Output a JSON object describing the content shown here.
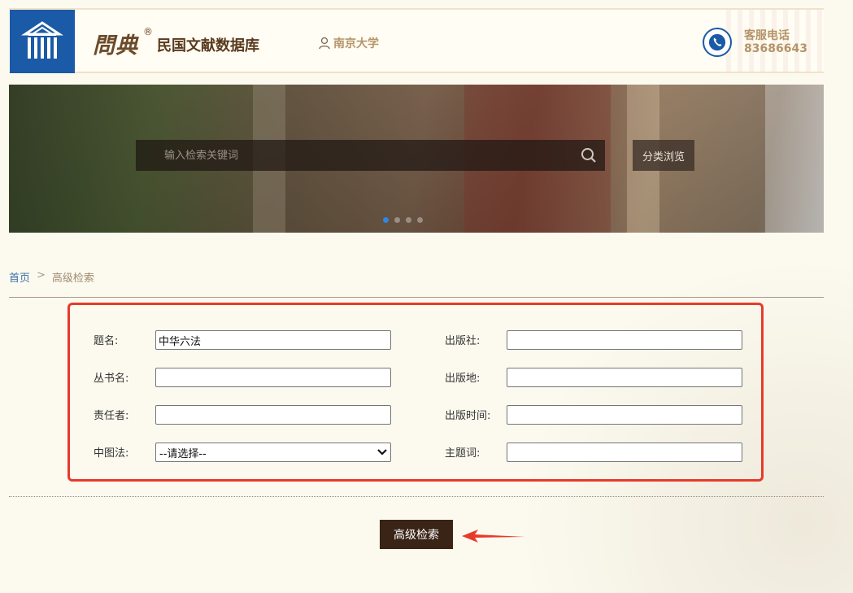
{
  "header": {
    "brand_calligraphy": "問典",
    "brand_registered": "®",
    "brand_name": "民国文献数据库",
    "user": "南京大学",
    "phone_label": "客服电话",
    "phone_number": "83686643"
  },
  "banner": {
    "search_placeholder": "输入检索关键词",
    "browse_label": "分类浏览",
    "active_slide": 1,
    "slide_count": 4
  },
  "breadcrumb": {
    "home": "首页",
    "separator": ">",
    "current": "高级检索"
  },
  "form": {
    "title_label": "题名:",
    "title_value": "中华六法",
    "series_label": "丛书名:",
    "series_value": "",
    "author_label": "责任者:",
    "author_value": "",
    "clc_label": "中图法:",
    "clc_value": "--请选择--",
    "publisher_label": "出版社:",
    "publisher_value": "",
    "place_label": "出版地:",
    "place_value": "",
    "date_label": "出版时间:",
    "date_value": "",
    "subject_label": "主题词:",
    "subject_value": ""
  },
  "actions": {
    "advanced_search": "高级检索"
  },
  "colors": {
    "brand_blue": "#1a5aa6",
    "button_dark": "#3a2416",
    "highlight_red": "#e83a2a"
  }
}
